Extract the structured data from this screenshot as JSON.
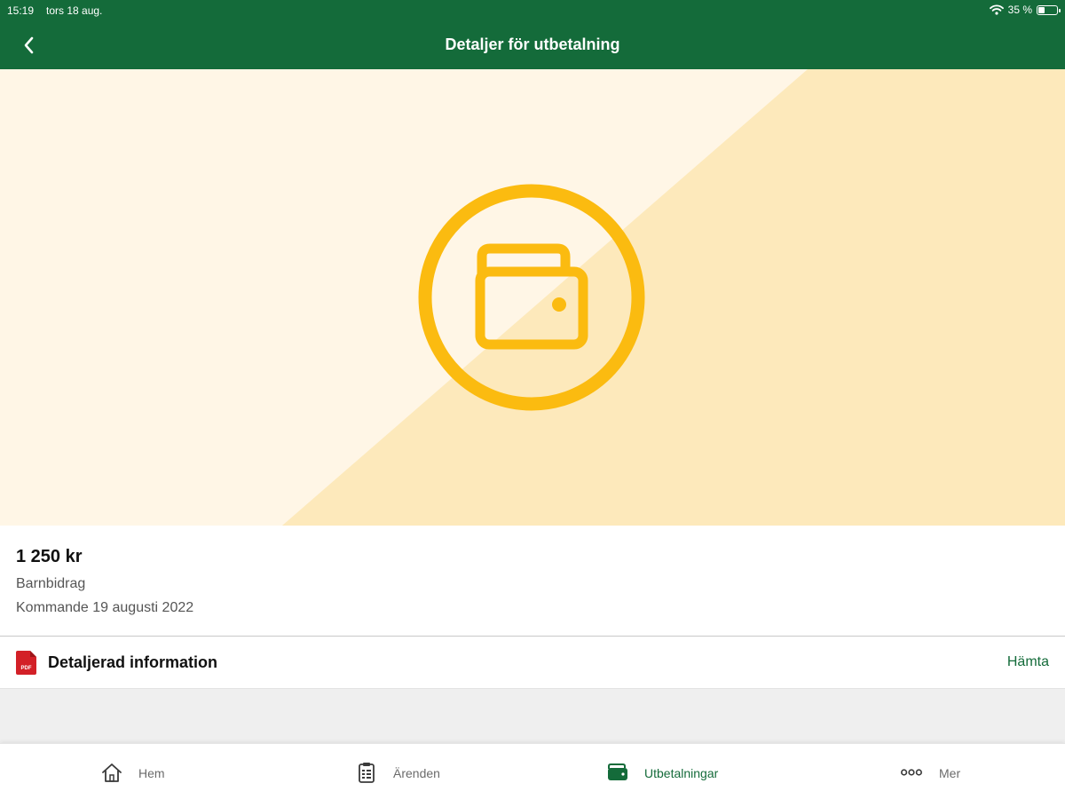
{
  "status_bar": {
    "time": "15:19",
    "date": "tors 18 aug.",
    "battery": "35 %",
    "battery_level": 0.35
  },
  "header": {
    "title": "Detaljer för utbetalning",
    "back_icon": "chevron-left-icon"
  },
  "hero": {
    "icon": "wallet-icon",
    "colors": {
      "background_light": "#fff6e6",
      "background_dark": "#fde9bb",
      "accent": "#fbbb10"
    }
  },
  "payment": {
    "amount": "1 250 kr",
    "type": "Barnbidrag",
    "date": "Kommande 19 augusti 2022"
  },
  "document": {
    "label": "Detaljerad information",
    "icon": "pdf-icon",
    "pdf_badge": "PDF",
    "action": "Hämta"
  },
  "tabs": [
    {
      "label": "Hem",
      "icon": "home-icon",
      "active": false
    },
    {
      "label": "Ärenden",
      "icon": "clipboard-icon",
      "active": false
    },
    {
      "label": "Utbetalningar",
      "icon": "wallet-icon",
      "active": true
    },
    {
      "label": "Mer",
      "icon": "more-dots-icon",
      "active": false
    }
  ],
  "colors": {
    "brand_green": "#146b3a",
    "pdf_red": "#d32027"
  }
}
